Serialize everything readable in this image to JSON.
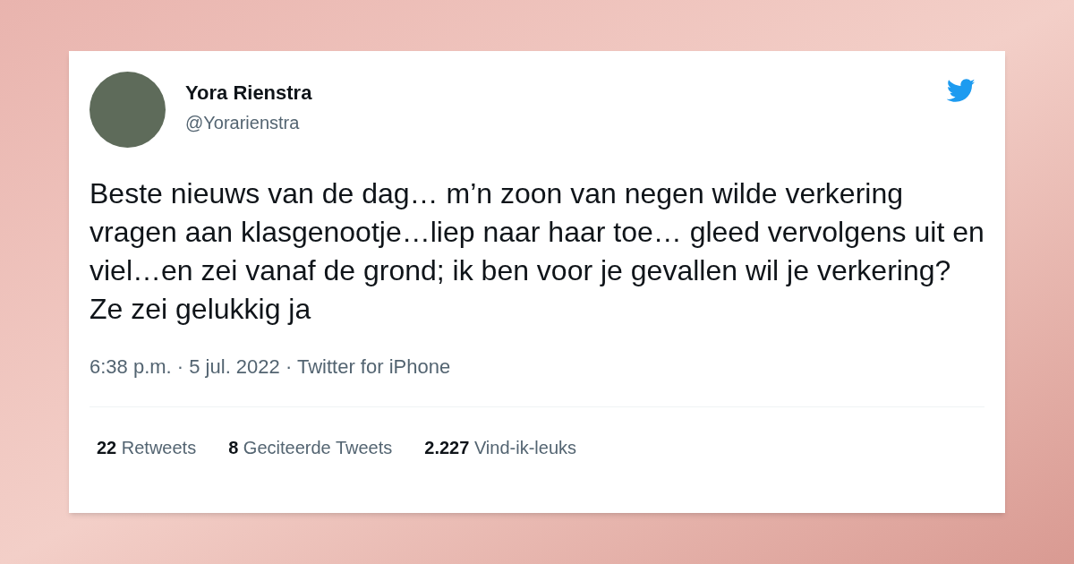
{
  "author": {
    "name": "Yora Rienstra",
    "handle": "@Yorarienstra"
  },
  "tweet": {
    "text": "Beste nieuws van de dag… m’n zoon van negen wilde verkering vragen aan klasgenootje…liep naar haar toe… gleed vervolgens uit en viel…en zei vanaf de grond; ik ben voor je gevallen wil je verkering? Ze zei gelukkig ja",
    "meta": "6:38 p.m. · 5 jul. 2022 · Twitter for iPhone"
  },
  "stats": [
    {
      "count": "22",
      "label": "Retweets"
    },
    {
      "count": "8",
      "label": "Geciteerde Tweets"
    },
    {
      "count": "2.227",
      "label": "Vind-ik-leuks"
    }
  ]
}
